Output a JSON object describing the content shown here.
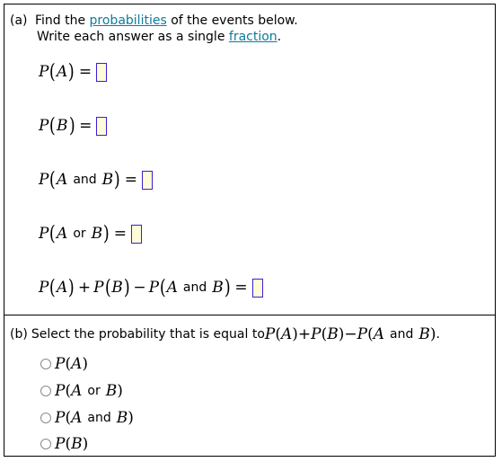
{
  "part_a": {
    "label": "(a)",
    "line1_prefix": "Find the ",
    "line1_link": "probabilities",
    "line1_suffix": " of the events below.",
    "line2_prefix": "Write each answer as a single ",
    "line2_link": "fraction",
    "line2_suffix": ".",
    "equations": [
      {
        "id": "p-a",
        "value": ""
      },
      {
        "id": "p-b",
        "value": ""
      },
      {
        "id": "p-a-and-b",
        "value": ""
      },
      {
        "id": "p-a-or-b",
        "value": ""
      },
      {
        "id": "p-a-plus-p-b-minus-p-a-and-b",
        "value": ""
      }
    ],
    "symbols": {
      "P": "P",
      "A": "A",
      "B": "B",
      "lparen": "(",
      "rparen": ")",
      "equals": "=",
      "plus": "+",
      "minus": "−",
      "and": "and",
      "or": "or"
    }
  },
  "part_b": {
    "label": "(b)",
    "prompt": "Select the probability that is equal to ",
    "prompt_end": ".",
    "options": [
      {
        "label": "P(A)",
        "selected": false
      },
      {
        "label": "P(A or B)",
        "selected": false
      },
      {
        "label": "P(A and B)",
        "selected": false
      },
      {
        "label": "P(B)",
        "selected": false
      }
    ]
  },
  "colors": {
    "link": "#0c7c9c",
    "input_border": "#3a1fd6",
    "input_fill": "#fefcd8"
  }
}
